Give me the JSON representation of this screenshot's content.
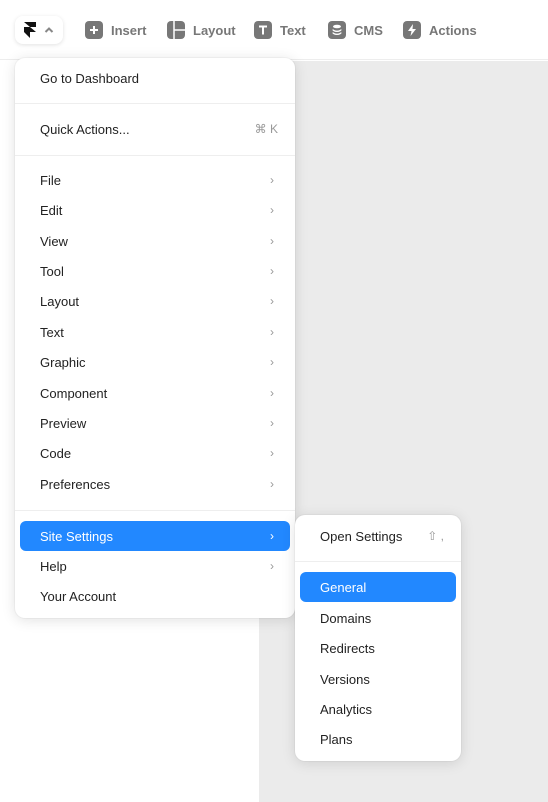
{
  "toolbar": {
    "logo": "framer-logo-icon",
    "items": [
      {
        "label": "Insert",
        "icon": "plus-icon"
      },
      {
        "label": "Layout",
        "icon": "layout-icon"
      },
      {
        "label": "Text",
        "icon": "text-icon"
      },
      {
        "label": "CMS",
        "icon": "database-icon"
      },
      {
        "label": "Actions",
        "icon": "bolt-icon"
      }
    ]
  },
  "main_menu": {
    "go_to_dashboard": "Go to Dashboard",
    "quick_actions": {
      "label": "Quick Actions...",
      "shortcut": "⌘ K"
    },
    "items": [
      {
        "label": "File"
      },
      {
        "label": "Edit"
      },
      {
        "label": "View"
      },
      {
        "label": "Tool"
      },
      {
        "label": "Layout"
      },
      {
        "label": "Text"
      },
      {
        "label": "Graphic"
      },
      {
        "label": "Component"
      },
      {
        "label": "Preview"
      },
      {
        "label": "Code"
      },
      {
        "label": "Preferences"
      }
    ],
    "site_settings": "Site Settings",
    "help": "Help",
    "your_account": "Your Account",
    "chevron": "›"
  },
  "sub_menu": {
    "open_settings": {
      "label": "Open Settings",
      "shortcut": "⇧ ,"
    },
    "items": [
      {
        "label": "General",
        "active": true
      },
      {
        "label": "Domains"
      },
      {
        "label": "Redirects"
      },
      {
        "label": "Versions"
      },
      {
        "label": "Analytics"
      },
      {
        "label": "Plans"
      }
    ]
  },
  "colors": {
    "accent": "#2288ff",
    "canvas": "#ebebeb"
  }
}
